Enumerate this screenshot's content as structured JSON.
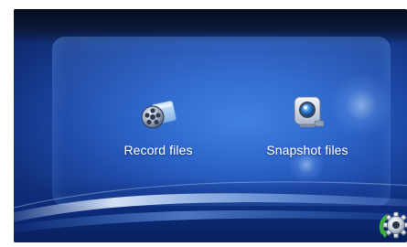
{
  "menu": {
    "items": [
      {
        "label": "Record files",
        "icon": "film-reel-folder-icon"
      },
      {
        "label": "Snapshot files",
        "icon": "camera-photo-icon"
      }
    ]
  },
  "toolbar": {
    "settings_icon": "gear-icon"
  },
  "colors": {
    "background_primary": "#2a62c8",
    "background_dark": "#0b1a3d",
    "label_text": "#ffffff",
    "settings_accent": "#3fae3c"
  }
}
